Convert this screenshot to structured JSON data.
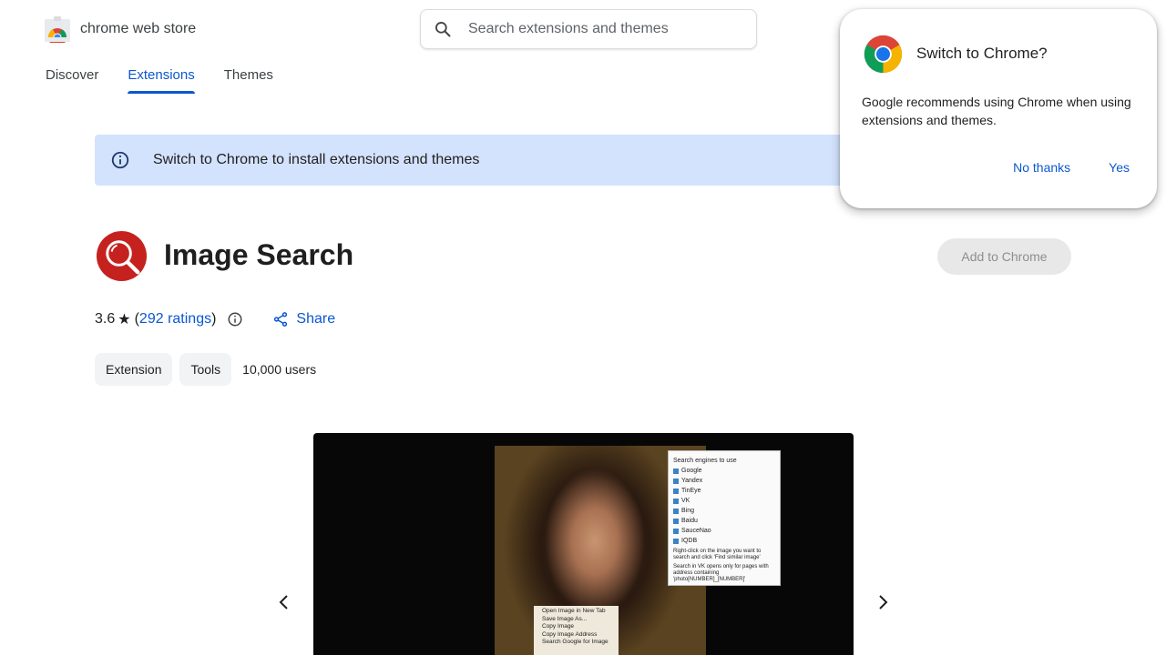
{
  "header": {
    "store_name": "chrome web store",
    "search_placeholder": "Search extensions and themes"
  },
  "nav": {
    "items": [
      {
        "label": "Discover",
        "active": false
      },
      {
        "label": "Extensions",
        "active": true
      },
      {
        "label": "Themes",
        "active": false
      }
    ]
  },
  "banner": {
    "text": "Switch to Chrome to install extensions and themes"
  },
  "extension": {
    "title": "Image Search",
    "add_button": "Add to Chrome",
    "rating": "3.6",
    "ratings_link": "292 ratings",
    "share_label": "Share",
    "chips": [
      "Extension",
      "Tools"
    ],
    "users": "10,000 users"
  },
  "screenshot": {
    "panel_title": "Search engines to use",
    "engines": [
      "Google",
      "Yandex",
      "TinEye",
      "VK",
      "Bing",
      "Baidu",
      "SauceNao",
      "IQDB"
    ],
    "note1": "Right-click on the image you want to search and click 'Find similar image'",
    "note2": "Search in VK opens only for pages with address containing 'photo[NUMBER]_[NUMBER]'",
    "context_menu": [
      "Open Image in New Tab",
      "Save Image As...",
      "Copy Image",
      "Copy Image Address",
      "Search Google for Image"
    ]
  },
  "dialog": {
    "title": "Switch to Chrome?",
    "body": "Google recommends using Chrome when using extensions and themes.",
    "no_label": "No thanks",
    "yes_label": "Yes"
  },
  "colors": {
    "accent": "#0b57d0",
    "banner_bg": "#d3e3fd",
    "icon_red": "#c5221f"
  }
}
